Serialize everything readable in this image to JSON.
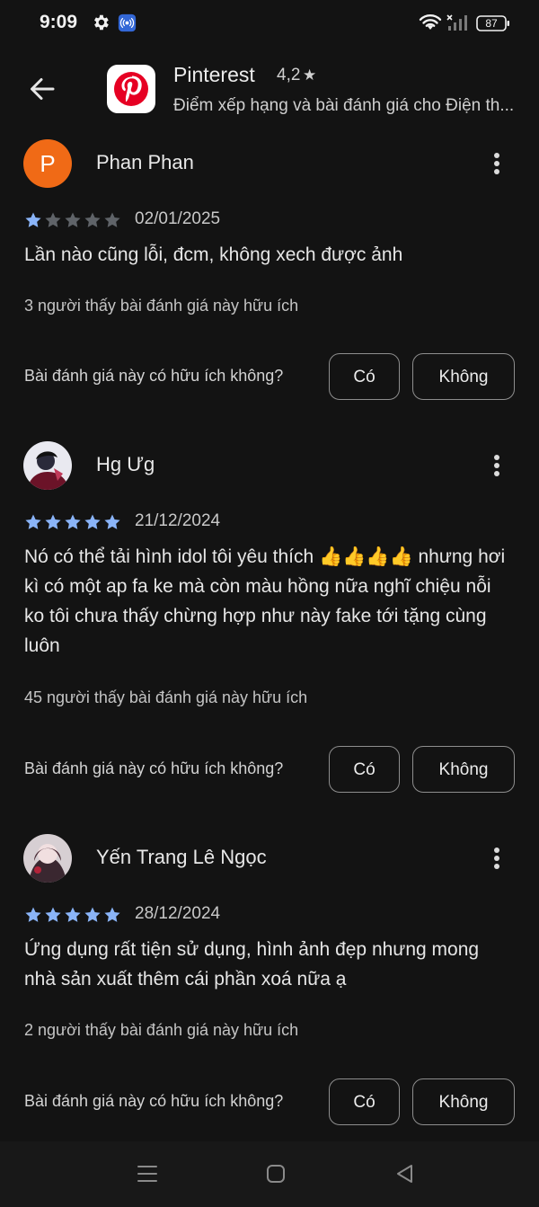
{
  "status_bar": {
    "time": "9:09",
    "battery": "87",
    "icons": [
      "gear-icon",
      "cast-icon",
      "wifi-icon",
      "signal-icon",
      "battery-icon"
    ]
  },
  "app": {
    "name": "Pinterest",
    "rating": "4,2",
    "rating_star": "★",
    "subtitle": "Điểm xếp hạng và bài đánh giá cho Điện th...",
    "icon": "pinterest-logo"
  },
  "reviews": [
    {
      "author": "Phan Phan",
      "avatar_letter": "P",
      "avatar_color": "#f06a16",
      "stars": 1,
      "date": "02/01/2025",
      "text": "Lần nào cũng lỗi, đcm, không xech được ảnh",
      "helpful_count": "3 người thấy bài đánh giá này hữu ích",
      "helpful_question": "Bài đánh giá này có hữu ích không?",
      "yes_label": "Có",
      "no_label": "Không"
    },
    {
      "author": "Hg Ưg",
      "avatar_letter": "",
      "stars": 5,
      "date": "21/12/2024",
      "text": "Nó có thể tải hình idol tôi yêu thích 👍👍👍👍 nhưng hơi kì có một ap fa ke mà còn màu hồng nữa nghĩ chiệu nỗi ko tôi chưa thấy chừng hợp như này fake tới tặng cùng luôn",
      "helpful_count": "45 người thấy bài đánh giá này hữu ích",
      "helpful_question": "Bài đánh giá này có hữu ích không?",
      "yes_label": "Có",
      "no_label": "Không"
    },
    {
      "author": "Yến Trang Lê Ngọc",
      "avatar_letter": "",
      "stars": 5,
      "date": "28/12/2024",
      "text": "Ứng dụng rất tiện sử dụng, hình ảnh đẹp nhưng mong nhà sản xuất thêm cái phần xoá nữa ạ",
      "helpful_count": "2 người thấy bài đánh giá này hữu ích",
      "helpful_question": "Bài đánh giá này có hữu ích không?",
      "yes_label": "Có",
      "no_label": "Không"
    }
  ],
  "colors": {
    "background": "#131313",
    "star_filled": "#8ab4f8",
    "star_empty": "#5f6368",
    "brand_red": "#e60023"
  }
}
